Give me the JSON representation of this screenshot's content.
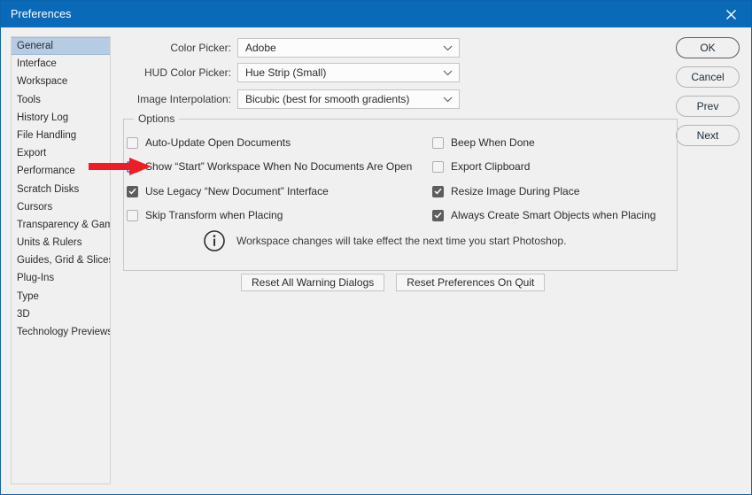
{
  "window": {
    "title": "Preferences",
    "close_icon": "close-icon",
    "titlebar_color": "#0b6ab8"
  },
  "sidebar": {
    "items": [
      {
        "label": "General",
        "selected": true
      },
      {
        "label": "Interface",
        "selected": false
      },
      {
        "label": "Workspace",
        "selected": false
      },
      {
        "label": "Tools",
        "selected": false
      },
      {
        "label": "History Log",
        "selected": false
      },
      {
        "label": "File Handling",
        "selected": false
      },
      {
        "label": "Export",
        "selected": false
      },
      {
        "label": "Performance",
        "selected": false
      },
      {
        "label": "Scratch Disks",
        "selected": false
      },
      {
        "label": "Cursors",
        "selected": false
      },
      {
        "label": "Transparency & Gamut",
        "selected": false
      },
      {
        "label": "Units & Rulers",
        "selected": false
      },
      {
        "label": "Guides, Grid & Slices",
        "selected": false
      },
      {
        "label": "Plug-Ins",
        "selected": false
      },
      {
        "label": "Type",
        "selected": false
      },
      {
        "label": "3D",
        "selected": false
      },
      {
        "label": "Technology Previews",
        "selected": false
      }
    ],
    "selected_color": "#b6cce4"
  },
  "side_buttons": [
    {
      "label": "OK",
      "default": true
    },
    {
      "label": "Cancel",
      "default": false
    },
    {
      "label": "Prev",
      "default": false
    },
    {
      "label": "Next",
      "default": false
    }
  ],
  "fields": [
    {
      "label": "Color Picker:",
      "value": "Adobe",
      "icon": "chevron-down-icon"
    },
    {
      "label": "HUD Color Picker:",
      "value": "Hue Strip (Small)",
      "icon": "chevron-down-icon"
    },
    {
      "label": "Image Interpolation:",
      "value": "Bicubic (best for smooth gradients)",
      "icon": "chevron-down-icon"
    }
  ],
  "options": {
    "group_title": "Options",
    "left_column": [
      {
        "label": "Auto-Update Open Documents",
        "checked": false,
        "focused": false
      },
      {
        "label": "Show “Start” Workspace When No Documents Are Open",
        "checked": false,
        "focused": true
      },
      {
        "label": "Use Legacy “New Document” Interface",
        "checked": true,
        "focused": false
      },
      {
        "label": "Skip Transform when Placing",
        "checked": false,
        "focused": false
      }
    ],
    "right_column": [
      {
        "label": "Beep When Done",
        "checked": false,
        "focused": false
      },
      {
        "label": "Export Clipboard",
        "checked": false,
        "focused": false
      },
      {
        "label": "Resize Image During Place",
        "checked": true,
        "focused": false
      },
      {
        "label": "Always Create Smart Objects when Placing",
        "checked": true,
        "focused": false
      }
    ],
    "note": {
      "icon": "info-icon",
      "text": "Workspace changes will take effect the next time you start Photoshop."
    },
    "reset_buttons": [
      {
        "label": "Reset All Warning Dialogs"
      },
      {
        "label": "Reset Preferences On Quit"
      }
    ]
  },
  "annotation": {
    "arrow_icon": "red-arrow-right-icon",
    "arrow_color": "#ee1c25",
    "points_at": "Show “Start” Workspace When No Documents Are Open"
  }
}
